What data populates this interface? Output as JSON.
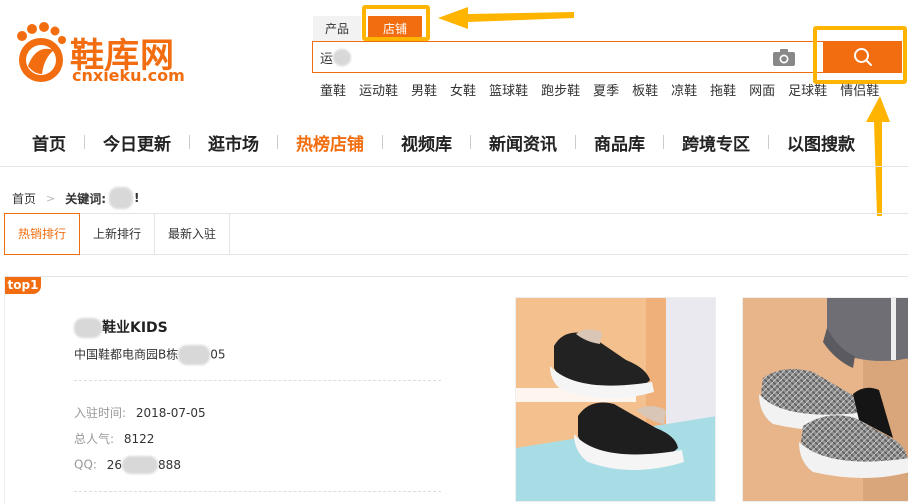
{
  "logo": {
    "text": "鞋库网",
    "domain": "cnxieku.com"
  },
  "search": {
    "tabs": [
      {
        "label": "产品",
        "active": false
      },
      {
        "label": "店铺",
        "active": true
      }
    ],
    "input_value": "运",
    "button_icon": "search-icon",
    "camera_icon": "camera-icon",
    "hot_words": [
      "童鞋",
      "运动鞋",
      "男鞋",
      "女鞋",
      "篮球鞋",
      "跑步鞋",
      "夏季",
      "板鞋",
      "凉鞋",
      "拖鞋",
      "网面",
      "足球鞋",
      "情侣鞋"
    ]
  },
  "nav": {
    "items": [
      {
        "label": "首页",
        "active": false
      },
      {
        "label": "今日更新",
        "active": false
      },
      {
        "label": "逛市场",
        "active": false
      },
      {
        "label": "热榜店铺",
        "active": true
      },
      {
        "label": "视频库",
        "active": false
      },
      {
        "label": "新闻资讯",
        "active": false
      },
      {
        "label": "商品库",
        "active": false
      },
      {
        "label": "跨境专区",
        "active": false
      },
      {
        "label": "以图搜款",
        "active": false
      }
    ]
  },
  "breadcrumb": {
    "home": "首页",
    "separator": ">",
    "keyword_label": "关键词:",
    "keyword_tail": "!"
  },
  "sort_tabs": [
    {
      "label": "热销排行",
      "active": true
    },
    {
      "label": "上新排行",
      "active": false
    },
    {
      "label": "最新入驻",
      "active": false
    }
  ],
  "shop": {
    "badge": "top1",
    "name_tail": "鞋业KIDS",
    "address_head": "中国鞋都电商园B栋",
    "address_tail": "05",
    "join_label": "入驻时间:",
    "join_value": "2018-07-05",
    "popularity_label": "总人气:",
    "popularity_value": "8122",
    "qq_label": "QQ:",
    "qq_head": "26",
    "qq_tail": "888"
  },
  "colors": {
    "accent": "#f26d0f",
    "annotation": "#ffb400"
  }
}
